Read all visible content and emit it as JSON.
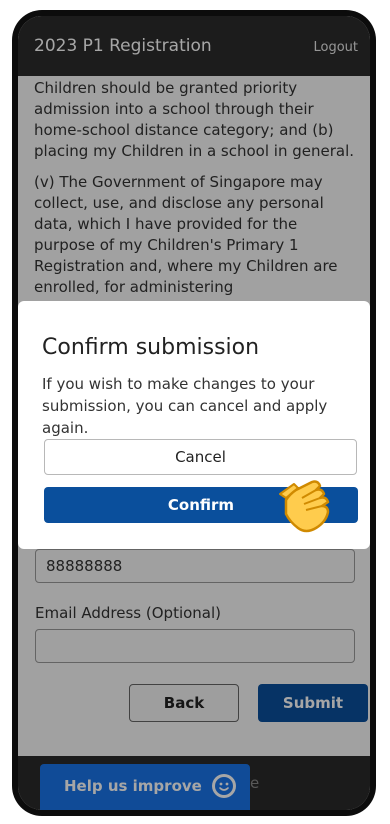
{
  "header": {
    "title": "2023 P1 Registration",
    "logout_label": "Logout"
  },
  "consent": {
    "paragraph1": "Children should be granted priority admission into a school through their home-school distance category; and (b) placing my Children in a school in general.",
    "paragraph2": "(v) The Government of Singapore may collect, use, and disclose any personal data, which I have provided for the purpose of my Children's Primary 1 Registration and, where my Children are enrolled, for administering"
  },
  "form": {
    "phone_value": "88888888",
    "email_label": "Email Address (Optional)",
    "email_value": ""
  },
  "actions": {
    "back_label": "Back",
    "submit_label": "Submit"
  },
  "modal": {
    "title": "Confirm submission",
    "body": "If you wish to make changes to your submission, you can cancel and apply again.",
    "cancel_label": "Cancel",
    "confirm_label": "Confirm"
  },
  "footer": {
    "help_label": "Help us improve",
    "partial_text": "e"
  },
  "colors": {
    "primary": "#0a4f9c",
    "header_bg": "#2b2b2b",
    "help_button": "#1a73e8"
  }
}
